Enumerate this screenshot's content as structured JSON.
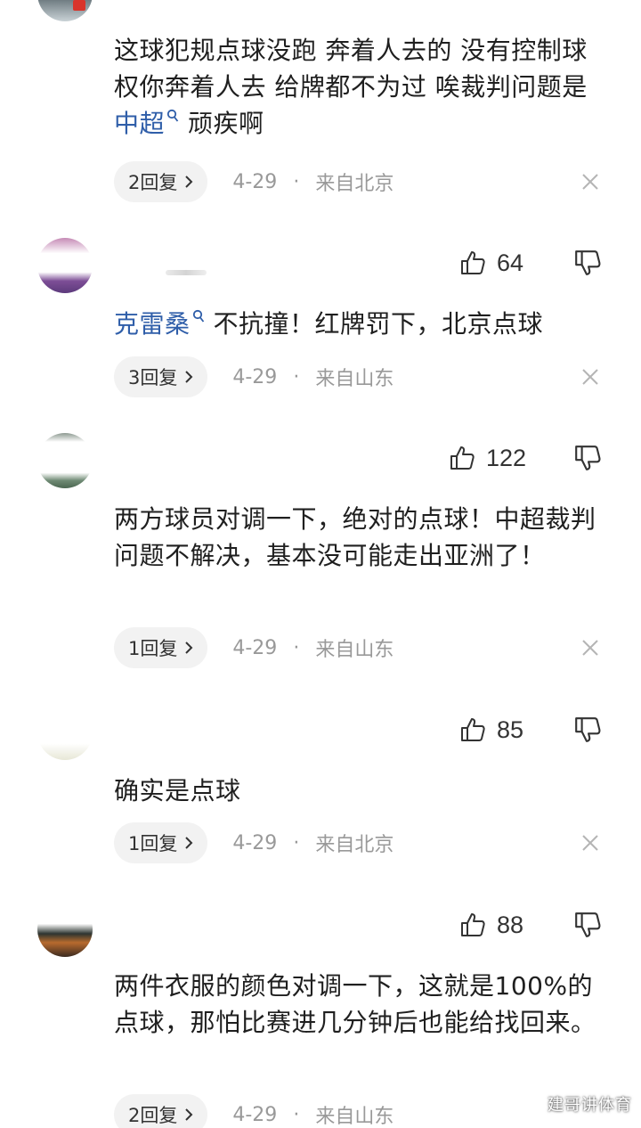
{
  "comments": [
    {
      "text_parts": [
        "这球犯规点球没跑 奔着人去的 没有控制球权你奔着人去 给牌都不为过 唉裁判问题是",
        "中超",
        "顽疾啊"
      ],
      "reply_label": "2回复",
      "date": "4-29",
      "dot": "·",
      "location": "来自北京"
    },
    {
      "likes": "64",
      "link": "克雷桑",
      "text": "不抗撞！红牌罚下，北京点球",
      "reply_label": "3回复",
      "date": "4-29",
      "dot": "·",
      "location": "来自山东"
    },
    {
      "likes": "122",
      "text": "两方球员对调一下，绝对的点球！中超裁判问题不解决，基本没可能走出亚洲了！",
      "reply_label": "1回复",
      "date": "4-29",
      "dot": "·",
      "location": "来自山东"
    },
    {
      "likes": "85",
      "text": "确实是点球",
      "reply_label": "1回复",
      "date": "4-29",
      "dot": "·",
      "location": "来自北京"
    },
    {
      "likes": "88",
      "text": "两件衣服的颜色对调一下，这就是100%的点球，那怕比赛进几分钟后也能给找回来。",
      "reply_label": "2回复",
      "date": "4-29",
      "dot": "·",
      "location": "来自山东"
    }
  ],
  "watermark": "建哥讲体育",
  "colors": {
    "link": "#2f5ea9",
    "meta": "#999999",
    "reply_bg": "#f2f2f2"
  },
  "icons": [
    "thumbs-up-icon",
    "thumbs-down-icon",
    "close-icon",
    "search-link-icon",
    "chevron-right-icon"
  ]
}
